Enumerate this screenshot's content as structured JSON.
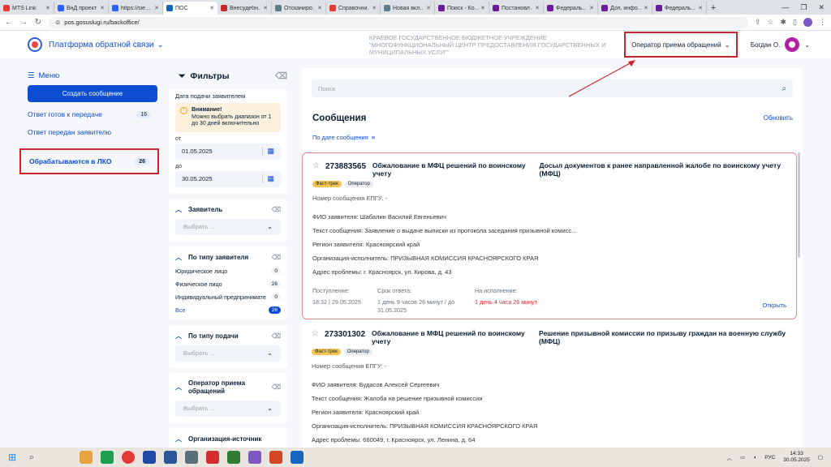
{
  "browser": {
    "tabs": [
      {
        "label": "MTS Link",
        "color": "#e53935"
      },
      {
        "label": "ВнД проект",
        "color": "#2962ff"
      },
      {
        "label": "https://sie…",
        "color": "#2962ff"
      },
      {
        "label": "ПОС",
        "color": "#1565c0",
        "active": true
      },
      {
        "label": "Внесудебн…",
        "color": "#c62828"
      },
      {
        "label": "Отсканиро…",
        "color": "#607d8b"
      },
      {
        "label": "Справочни…",
        "color": "#e53935"
      },
      {
        "label": "Новая вкл…",
        "color": "#607d8b"
      },
      {
        "label": "Поиск - Ко…",
        "color": "#6a1b9a"
      },
      {
        "label": "Постановл…",
        "color": "#6a1b9a"
      },
      {
        "label": "Федераль…",
        "color": "#6a1b9a"
      },
      {
        "label": "Доп. инфо…",
        "color": "#6a1b9a"
      },
      {
        "label": "Федераль…",
        "color": "#6a1b9a"
      }
    ],
    "url": "pos.gosuslugi.ru/backoffice/"
  },
  "header": {
    "platform": "Платформа обратной связи",
    "org": "КРАЕВОЕ ГОСУДАРСТВЕННОЕ БЮДЖЕТНОЕ УЧРЕЖДЕНИЕ \"МНОГОФУНКЦИОНАЛЬНЫЙ ЦЕНТР ПРЕДОСТАВЛЕНИЯ ГОСУДАРСТВЕННЫХ И МУНИЦИПАЛЬНЫХ УСЛУГ\"",
    "role": "Оператор приема обращений",
    "user": "Богдан О."
  },
  "menu": {
    "title": "Меню",
    "create": "Создать сообщение",
    "items": [
      {
        "label": "Ответ готов к передаче",
        "count": "16"
      },
      {
        "label": "Ответ передан заявителю",
        "count": ""
      },
      {
        "label": "Обрабатываются в ЛКО",
        "count": "26"
      }
    ]
  },
  "filters": {
    "title": "Фильтры",
    "date_label": "Дата подачи заявителем",
    "warn_title": "Внимание!",
    "warn_text": "Можно выбрать диапазон от 1 до 30 дней включительно",
    "from_label": "от",
    "from": "01.05.2025",
    "to_label": "до",
    "to": "30.05.2025",
    "applicant": "Заявитель",
    "select_placeholder": "Выбрать ...",
    "by_type": "По типу заявителя",
    "types": [
      {
        "label": "Юридическое лицо",
        "count": "0"
      },
      {
        "label": "Физическое лицо",
        "count": "26"
      },
      {
        "label": "Индивидуальный предприниматель",
        "count": "0"
      }
    ],
    "all_label": "Все",
    "all_count": "26",
    "by_submit": "По типу подачи",
    "operator": "Оператор приема обращений",
    "org_source": "Организация-источник"
  },
  "main": {
    "search_placeholder": "Поиск",
    "title": "Сообщения",
    "refresh": "Обновить",
    "sort": "По дате сообщения",
    "messages": [
      {
        "num": "273883565",
        "topic": "Обжалование в МФЦ решений по воинскому учету",
        "doc": "Досыл документов к ранее направленной жалобе по воинскому учету (МФЦ)",
        "tag1": "Фаст-трек",
        "tag2": "Оператор",
        "epgu": "Номер сообщения ЕПГУ: -",
        "fio": "ФИО заявителя: Шабалин Василий Евгеньевич",
        "text": "Текст сообщения: Заявление о выдаче выписки из протокола заседания призывной комисс...",
        "region": "Регион заявителя: Красноярский край",
        "executor": "Организация-исполнитель: ПРИЗЫВНАЯ КОМИССИЯ КРАСНОЯРСКОГО КРАЯ",
        "address": "Адрес проблемы: г. Красноярск, ул. Кирова, д. 43",
        "received_label": "Поступление:",
        "received": "18:32 | 29.05.2025",
        "deadline_label": "Срок ответа:",
        "deadline": "1 день 9 часов 26 минут / до 31.05.2025",
        "exec_label": "На исполнение:",
        "exec": "1 день 4 часа 26 минут",
        "open": "Открыть"
      },
      {
        "num": "273301302",
        "topic": "Обжалование в МФЦ решений по воинскому учету",
        "doc": "Решение призывной комиссии по призыву граждан на военную службу (МФЦ)",
        "tag1": "Фаст-трек",
        "tag2": "Оператор",
        "epgu": "Номер сообщения ЕПГУ: -",
        "fio": "ФИО заявителя: Будасов Алексей Сергеевич",
        "text": "Текст сообщения: Жалоба на решение призывной комиссии",
        "region": "Регион заявителя: Красноярский край",
        "executor": "Организация-исполнитель: ПРИЗЫВНАЯ КОМИССИЯ КРАСНОЯРСКОГО КРАЯ",
        "address": "Адрес проблемы: 660049, г. Красноярск, ул. Ленина, д. 64"
      }
    ]
  },
  "taskbar": {
    "lang": "РУС",
    "time": "14:33",
    "date": "30.05.2025"
  }
}
